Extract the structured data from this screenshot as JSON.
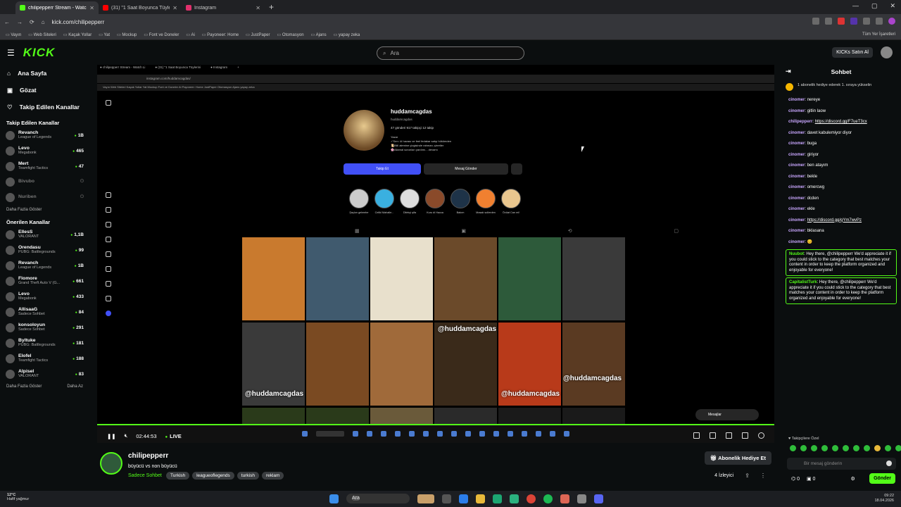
{
  "browser": {
    "tabs": [
      {
        "label": "chilipepperr Stream - Watch Li",
        "color": "#53fc18",
        "active": true
      },
      {
        "label": "(31) \"1 Saat Boyunca Tüylerini",
        "color": "#ff0000",
        "active": false
      },
      {
        "label": "Instagram",
        "color": "#e1306c",
        "active": false
      }
    ],
    "url": "kick.com/chilipepperr",
    "bookmarks": [
      "Vayın",
      "Web Siteleri",
      "Kaçak Yollar",
      "Yat",
      "Mockup",
      "Font ve Doneler",
      "Ai",
      "Payoneer: Home",
      "JustPaper",
      "Otomasyon",
      "Ajans",
      "yapay zeka"
    ],
    "bookmarks_right": "Tüm Yer İşaretleri"
  },
  "header": {
    "logo": "KICK",
    "search_placeholder": "Ara",
    "buy_ai": "KICKs Satın Al"
  },
  "sidebar": {
    "nav": [
      {
        "label": "Ana Sayfa",
        "icon": "home-icon"
      },
      {
        "label": "Gözat",
        "icon": "browse-icon"
      },
      {
        "label": "Takip Edilen Kanallar",
        "icon": "heart-icon"
      }
    ],
    "followed_title": "Takip Edilen Kanallar",
    "followed": [
      {
        "name": "Revanch",
        "game": "League of Legends",
        "viewers": "1B"
      },
      {
        "name": "Levo",
        "game": "Megabonk",
        "viewers": "465"
      },
      {
        "name": "Mert",
        "game": "Teamfight Tactics",
        "viewers": "47"
      },
      {
        "name": "Bivubo",
        "game": "",
        "viewers": ""
      },
      {
        "name": "Nuriben",
        "game": "",
        "viewers": ""
      }
    ],
    "show_more": "Daha Fazla Göster",
    "recommended_title": "Önerilen Kanallar",
    "recommended": [
      {
        "name": "EllesS",
        "game": "VALORANT",
        "viewers": "1,1B"
      },
      {
        "name": "Orendasu",
        "game": "PUBG: Battlegrounds",
        "viewers": "99"
      },
      {
        "name": "Revanch",
        "game": "League of Legends",
        "viewers": "1B"
      },
      {
        "name": "Flomore",
        "game": "Grand Theft Auto V (G...",
        "viewers": "661"
      },
      {
        "name": "Levo",
        "game": "Megabonk",
        "viewers": "433"
      },
      {
        "name": "AllisaaG",
        "game": "Sadece Sohbet",
        "viewers": "84"
      },
      {
        "name": "konsoloyun",
        "game": "Sadece Sohbet",
        "viewers": "291"
      },
      {
        "name": "Byltuke",
        "game": "PUBG: Battlegrounds",
        "viewers": "181"
      },
      {
        "name": "Elofel",
        "game": "Teamfight Tactics",
        "viewers": "188"
      },
      {
        "name": "Alpisel",
        "game": "VALORANT",
        "viewers": "83"
      }
    ],
    "show_more_2": "Daha Fazla Göster",
    "show_less": "Daha Az"
  },
  "stream_screen": {
    "ig_username": "huddamcagdas",
    "ig_sub": "huddamcagdas",
    "ig_stats": "47 gönderi   917 takipçi   12 takip",
    "ig_bio": "Yazar\n✓Sırrı: ül havası ve feel fedakar satıp hükümden\n📜Bilil alemine çizgisinde rahman; şirretler\n🌸Allamal sorunları yardımı... devamı",
    "follow_btn": "Takip Et",
    "message_btn": "Mesaj Gönder",
    "highlights": [
      "Şaçlon gelmeler",
      "Celikl Mahalle...",
      "Dilekçi şifa",
      "Kuru di Hacca",
      "Bakım",
      "Masalı sollerden",
      "Övüat Can mi!"
    ],
    "watermark": "@huddamcagdas",
    "messages_pill": "Mesajlar"
  },
  "controls": {
    "time": "02:44:53",
    "live": "LIVE"
  },
  "stream_info": {
    "streamer": "chilipepperr",
    "title": "büyücü vs non büyücü",
    "category": "Sadece Sohbet",
    "tags": [
      "Turkish",
      "leagueoflegends",
      "turkish",
      "reklam"
    ],
    "subscribe": "Abonelik Hediye Et",
    "viewers": "4 İzleyici"
  },
  "chat": {
    "title": "Sohbet",
    "pinned": "1 abonelik hediye ederek 1. sıraya yükselin",
    "messages": [
      {
        "user": "cinomer",
        "text": "nereye"
      },
      {
        "user": "cinomer",
        "text": "gitlin laow"
      },
      {
        "user": "chilipepperr",
        "text": "https://discord.gg/F7ueT3cx",
        "link": true
      },
      {
        "user": "cinomer",
        "text": "davet kabulemiyor diyor"
      },
      {
        "user": "cinomer",
        "text": "buga"
      },
      {
        "user": "cinomer",
        "text": "giriyor"
      },
      {
        "user": "cinomer",
        "text": "ben atayım"
      },
      {
        "user": "cinomer",
        "text": "bekle"
      },
      {
        "user": "cinomer",
        "text": "omercwg"
      },
      {
        "user": "cinomer",
        "text": "dcden"
      },
      {
        "user": "cinomer",
        "text": "ekle"
      },
      {
        "user": "cinomer",
        "text": "https://discord.gg/gYm7wvPz",
        "link": true
      },
      {
        "user": "cinomer",
        "text": "bklasana"
      },
      {
        "user": "cinomer",
        "text": "😊"
      }
    ],
    "bot_messages": [
      {
        "user": "Nuubot",
        "text": "Hey there, @chilipepperr We'd appreciate it if you could stick to the category that best matches your content in order to keep the platform organized and enjoyable for everyone!"
      },
      {
        "user": "CapitalistTurk",
        "text": "Hey there, @chilipepperr We'd appreciate it if you could stick to the category that best matches your content in order to keep the platform organized and enjoyable for everyone!"
      }
    ],
    "followers_only": "Takipçilere Özel",
    "input_placeholder": "Bir mesaj gönderin",
    "points": "0",
    "kicks": "0",
    "send": "Gönder"
  },
  "taskbar": {
    "weather_temp": "12°C",
    "weather_desc": "Hafif yağmur",
    "search": "Ara",
    "time": "09:22",
    "date": "18.04.2026"
  }
}
